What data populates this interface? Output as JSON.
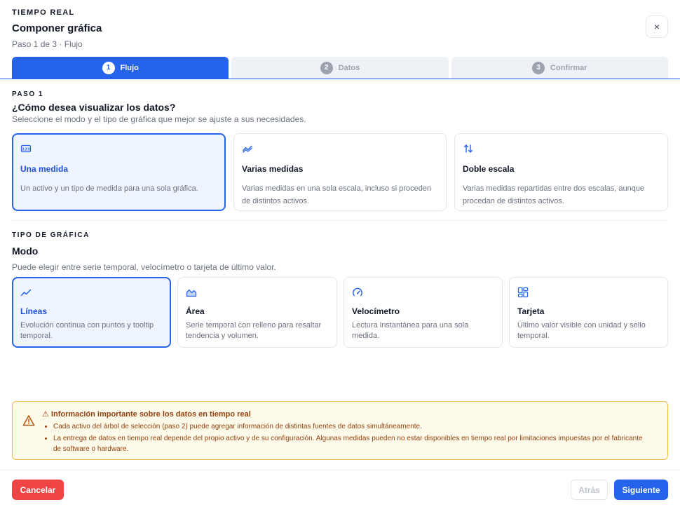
{
  "header": {
    "eyebrow": "TIEMPO REAL",
    "title": "Componer gráfica",
    "subtitle": "Paso 1 de 3 · Flujo",
    "close_label": "×"
  },
  "steps": [
    {
      "num": "1",
      "label": "Flujo",
      "active": true
    },
    {
      "num": "2",
      "label": "Datos",
      "active": false
    },
    {
      "num": "3",
      "label": "Confirmar",
      "active": false
    }
  ],
  "step1": {
    "label": "PASO 1",
    "title": "¿Cómo desea visualizar los datos?",
    "desc": "Seleccione el modo y el tipo de gráfica que mejor se ajuste a sus necesidades.",
    "options": [
      {
        "icon": "number-badge-icon",
        "title": "Una medida",
        "desc": "Un activo y un tipo de medida para una sola gráfica.",
        "selected": true
      },
      {
        "icon": "trend-lines-icon",
        "title": "Varias medidas",
        "desc": "Varias medidas en una sola escala, incluso si proceden de distintos activos.",
        "selected": false
      },
      {
        "icon": "swap-vertical-icon",
        "title": "Doble escala",
        "desc": "Varias medidas repartidas entre dos escalas, aunque procedan de distintos activos.",
        "selected": false
      }
    ]
  },
  "chart_type": {
    "label": "TIPO DE GRÁFICA",
    "title": "Modo",
    "desc": "Puede elegir entre serie temporal, velocímetro o tarjeta de último valor.",
    "options": [
      {
        "icon": "line-chart-icon",
        "title": "Líneas",
        "desc": "Evolución continua con puntos y tooltip temporal.",
        "selected": true
      },
      {
        "icon": "area-chart-icon",
        "title": "Área",
        "desc": "Serie temporal con relleno para resaltar tendencia y volumen.",
        "selected": false
      },
      {
        "icon": "gauge-icon",
        "title": "Velocímetro",
        "desc": "Lectura instantánea para una sola medida.",
        "selected": false
      },
      {
        "icon": "dashboard-grid-icon",
        "title": "Tarjeta",
        "desc": "Último valor visible con unidad y sello temporal.",
        "selected": false
      }
    ]
  },
  "alert": {
    "title": "⚠ Información importante sobre los datos en tiempo real",
    "items": [
      "Cada activo del árbol de selección (paso 2) puede agregar información de distintas fuentes de datos simultáneamente.",
      "La entrega de datos en tiempo real depende del propio activo y de su configuración. Algunas medidas pueden no estar disponibles en tiempo real por limitaciones impuestas por el fabricante de software o hardware."
    ]
  },
  "footer": {
    "cancel": "Cancelar",
    "back": "Atrás",
    "next": "Siguiente"
  },
  "colors": {
    "primary": "#2563eb",
    "danger": "#ef4444",
    "warning_border": "#f2b84a",
    "warning_text": "#92400e"
  }
}
